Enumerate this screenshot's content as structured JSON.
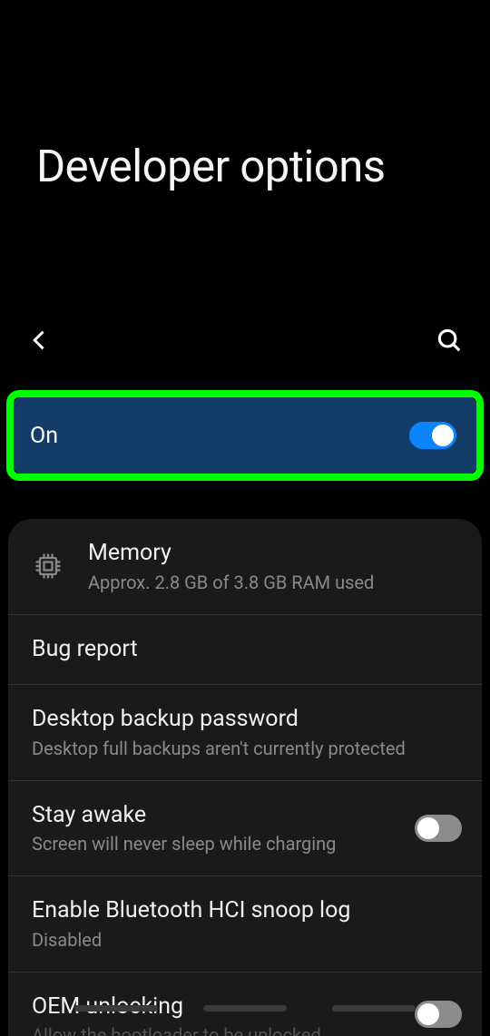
{
  "header": {
    "title": "Developer options"
  },
  "master_toggle": {
    "label": "On",
    "state": "on"
  },
  "items": [
    {
      "title": "Memory",
      "subtitle": "Approx. 2.8 GB of 3.8 GB RAM used",
      "has_icon": true,
      "has_switch": false
    },
    {
      "title": "Bug report",
      "subtitle": null,
      "has_icon": false,
      "has_switch": false
    },
    {
      "title": "Desktop backup password",
      "subtitle": "Desktop full backups aren't currently protected",
      "has_icon": false,
      "has_switch": false
    },
    {
      "title": "Stay awake",
      "subtitle": "Screen will never sleep while charging",
      "has_icon": false,
      "has_switch": true,
      "switch_state": "off"
    },
    {
      "title": "Enable Bluetooth HCI snoop log",
      "subtitle": "Disabled",
      "has_icon": false,
      "has_switch": false
    },
    {
      "title": "OEM unlocking",
      "subtitle": "Allow the bootloader to be unlocked",
      "has_icon": false,
      "has_switch": true,
      "switch_state": "off"
    }
  ]
}
